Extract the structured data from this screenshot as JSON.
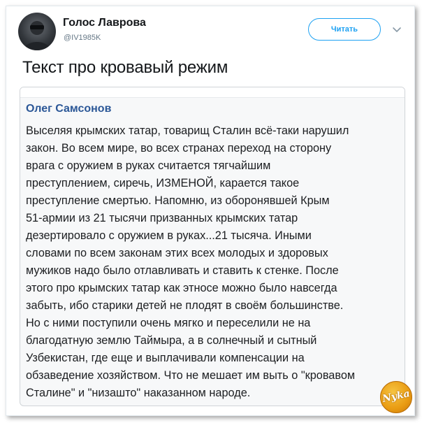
{
  "tweet": {
    "user_name": "Голос Лаврова",
    "user_handle": "@IV1985K",
    "follow_label": "Читать",
    "text": "Текст про кровавый режим",
    "avatar_icon": "user-avatar-icon",
    "menu_icon": "chevron-down-icon"
  },
  "quote": {
    "author": "Олег Самсонов",
    "lines": [
      "Выселяя крымских татар, товарищ Сталин всё-таки нарушил",
      "закон. Во всем мире, во всех странах переход на сторону",
      "врага с оружием в руках считается тягчайшим",
      "преступлением, сиречь, ИЗМЕНОЙ, карается такое",
      "преступление смертью. Напомню, из оборонявшей Крым",
      "51-армии из 21 тысячи призванных крымских татар",
      "дезертировало с оружием в руках...21 тысяча. Иными",
      "словами по всем законам этих всех молодых и здоровых",
      "мужиков надо было отлавливать и ставить к стенке. После",
      "этого про крымских татар как этносе можно было навсегда",
      "забыть, ибо старики детей не плодят в своём большинстве.",
      "Но с ними поступили очень мягко и переселили не на",
      "благодатную землю Таймыра, а в солнечный и сытный",
      "Узбекистан, где еще и выплачивали компенсации на",
      "обзаведение хозяйством. Что не мешает им выть о \"кровавом",
      "Сталине\" и \"низашто\" наказанном народе."
    ]
  },
  "watermark": {
    "text": "Nyka"
  },
  "colors": {
    "accent": "#1da1f2",
    "author_link": "#2b5797",
    "handle": "#657786"
  }
}
